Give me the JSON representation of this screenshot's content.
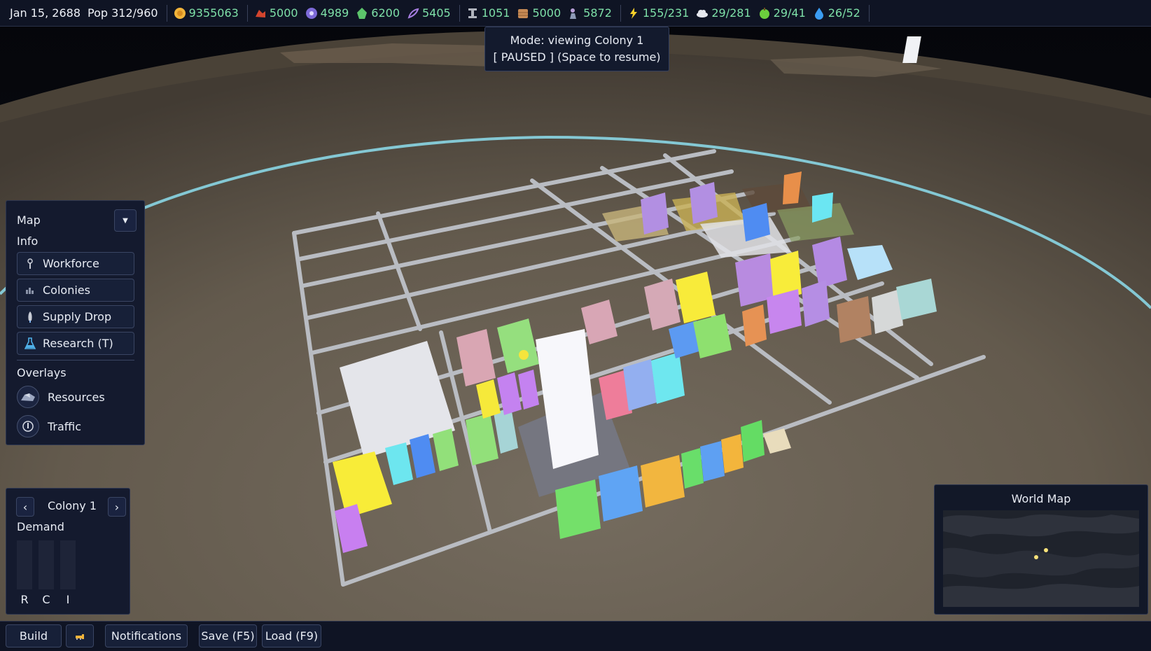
{
  "colors": {
    "accent_green": "#7ee0a8",
    "panel_bg": "#141a2e",
    "border": "#2c3550"
  },
  "topbar": {
    "date": "Jan 15, 2688",
    "population": "Pop 312/960",
    "resources": [
      {
        "icon": "coin-icon",
        "value": "9355063"
      },
      {
        "icon": "ore-icon",
        "value": "5000"
      },
      {
        "icon": "crystal-icon",
        "value": "4989"
      },
      {
        "icon": "mineral-icon",
        "value": "6200"
      },
      {
        "icon": "fiber-icon",
        "value": "5405"
      },
      {
        "icon": "steel-beam-icon",
        "value": "1051"
      },
      {
        "icon": "wood-icon",
        "value": "5000"
      },
      {
        "icon": "worker-icon",
        "value": "5872"
      },
      {
        "icon": "power-icon",
        "value": "155/231"
      },
      {
        "icon": "cloud-icon",
        "value": "29/281"
      },
      {
        "icon": "food-icon",
        "value": "29/41"
      },
      {
        "icon": "water-icon",
        "value": "26/52"
      }
    ]
  },
  "mode": {
    "line1": "Mode: viewing Colony 1",
    "line2": "[ PAUSED ]  (Space to resume)"
  },
  "left_panel": {
    "map_label": "Map",
    "info_label": "Info",
    "info_buttons": [
      {
        "label": "Workforce",
        "icon": "wrench-icon"
      },
      {
        "label": "Colonies",
        "icon": "city-icon"
      },
      {
        "label": "Supply Drop",
        "icon": "rocket-icon"
      },
      {
        "label": "Research (T)",
        "icon": "flask-icon"
      }
    ],
    "overlays_label": "Overlays",
    "overlays": [
      {
        "label": "Resources",
        "icon": "resources-icon"
      },
      {
        "label": "Traffic",
        "icon": "traffic-icon"
      }
    ]
  },
  "colony_panel": {
    "name": "Colony 1",
    "prev": "‹",
    "next": "›",
    "demand_label": "Demand",
    "demand": [
      {
        "label": "R",
        "level": 0
      },
      {
        "label": "C",
        "level": 0
      },
      {
        "label": "I",
        "level": 0
      }
    ]
  },
  "world_map": {
    "title": "World Map"
  },
  "bottom_bar": {
    "build": "Build",
    "notifications": "Notifications",
    "save": "Save (F5)",
    "load": "Load (F9)"
  }
}
